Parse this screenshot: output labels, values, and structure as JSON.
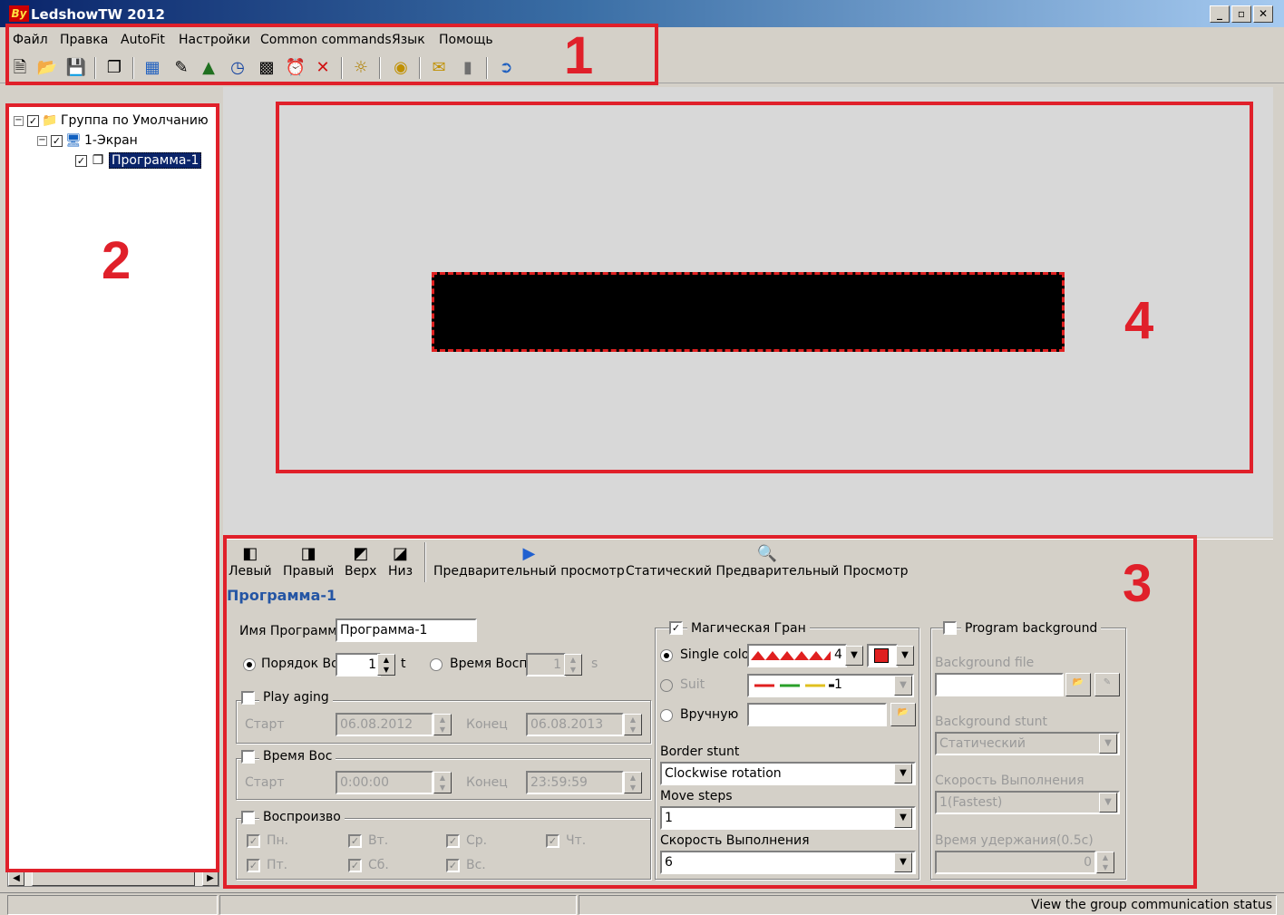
{
  "window": {
    "title": "LedshowTW 2012",
    "logo": "By",
    "minimize": "_",
    "restore": "▫",
    "close": "✕"
  },
  "menu": [
    "Файл",
    "Правка",
    "AutoFit",
    "Настройки",
    "Common commands",
    "Язык",
    "Помощь"
  ],
  "toolbar_icons": [
    "new-file-icon",
    "open-folder-icon",
    "save-icon",
    "program-icon",
    "table-icon",
    "text-edit-icon",
    "image-icon",
    "clock-icon",
    "calendar-icon",
    "alarm-icon",
    "delete-icon",
    "brightness-icon",
    "timer-icon",
    "send-icon",
    "usb-icon",
    "exit-icon"
  ],
  "tree": {
    "group": "Группа по Умолчанию",
    "screen": "1-Экран",
    "program": "Программа-1"
  },
  "preview_toolbar": {
    "left": "Левый",
    "right": "Правый",
    "top": "Верх",
    "bottom": "Низ",
    "preview": "Предварительный просмотр",
    "static_preview": "Статический Предварительный Просмотр"
  },
  "program": {
    "heading": "Программа-1",
    "name_label": "Имя Программы",
    "name_value": "Программа-1",
    "order_label": "Порядок Во",
    "order_value": "1",
    "order_unit": "t",
    "play_time_label": "Время Воспр",
    "play_time_value": "1",
    "play_time_unit": "s",
    "play_aging_label": "Play aging",
    "start_label": "Старт",
    "end_label": "Конец",
    "date_start": "06.08.2012",
    "date_end": "06.08.2013",
    "time_label": "Время Вос",
    "time_start": "0:00:00",
    "time_end": "23:59:59",
    "days_label": "Воспроизво",
    "days": [
      "Пн.",
      "Вт.",
      "Ср.",
      "Чт.",
      "Пт.",
      "Сб.",
      "Вс."
    ]
  },
  "border": {
    "magic_label": "Магическая Гран",
    "single_color_label": "Single color",
    "single_color_count": "4",
    "suit_label": "Suit",
    "suit_count": "1",
    "manual_label": "Вручную",
    "stunt_label": "Border stunt",
    "stunt_value": "Clockwise rotation",
    "move_steps_label": "Move steps",
    "move_steps_value": "1",
    "speed_label": "Скорость Выполнения",
    "speed_value": "6",
    "color": "#e02020"
  },
  "background": {
    "label": "Program background",
    "file_label": "Background file",
    "stunt_label": "Background stunt",
    "stunt_value": "Статический",
    "speed_label": "Скорость Выполнения",
    "speed_value": "1(Fastest)",
    "hold_label": "Время удержания(0.5с)",
    "hold_value": "0"
  },
  "status": {
    "text": "View the group communication status"
  },
  "annotations": [
    "1",
    "2",
    "3",
    "4"
  ],
  "colors": {
    "annotation": "#e0202a",
    "heading": "#2455a4",
    "selection": "#0a246a"
  }
}
